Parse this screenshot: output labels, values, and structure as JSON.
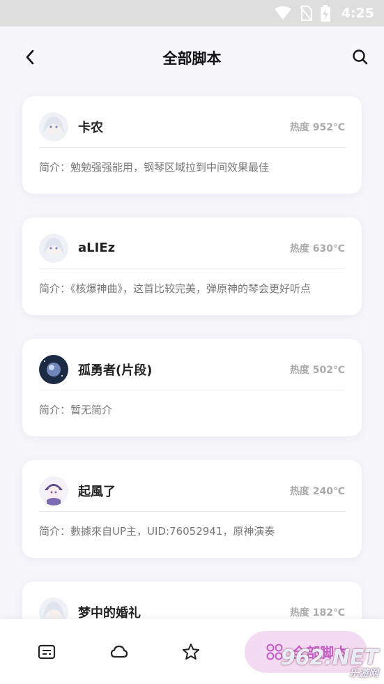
{
  "status_bar": {
    "time": "4:25"
  },
  "header": {
    "title": "全部脚本"
  },
  "scripts": [
    {
      "name": "卡农",
      "heat": "热度 952℃",
      "intro": "简介：勉勉强强能用，钢琴区域拉到中间效果最佳",
      "avatar": "girl-avatar"
    },
    {
      "name": "aLIEz",
      "heat": "热度 630℃",
      "intro": "简介：《核爆神曲》，这首比较完美，弹原神的琴会更好听点",
      "avatar": "girl-avatar"
    },
    {
      "name": "孤勇者(片段)",
      "heat": "热度 502℃",
      "intro": "简介：暂无简介",
      "avatar": "space-avatar"
    },
    {
      "name": "起風了",
      "heat": "热度 240℃",
      "intro": "简介：數據來自UP主，UID:76052941，原神演奏",
      "avatar": "purple-avatar"
    },
    {
      "name": "梦中的婚礼",
      "heat": "热度 182℃",
      "intro": "",
      "avatar": "girl-avatar"
    }
  ],
  "bottom_nav": {
    "items": [
      "script-list-icon",
      "cloud-icon",
      "star-icon"
    ],
    "active_label": "全部脚本"
  },
  "watermark": {
    "text": "962.NET",
    "sub": "乐游网"
  }
}
